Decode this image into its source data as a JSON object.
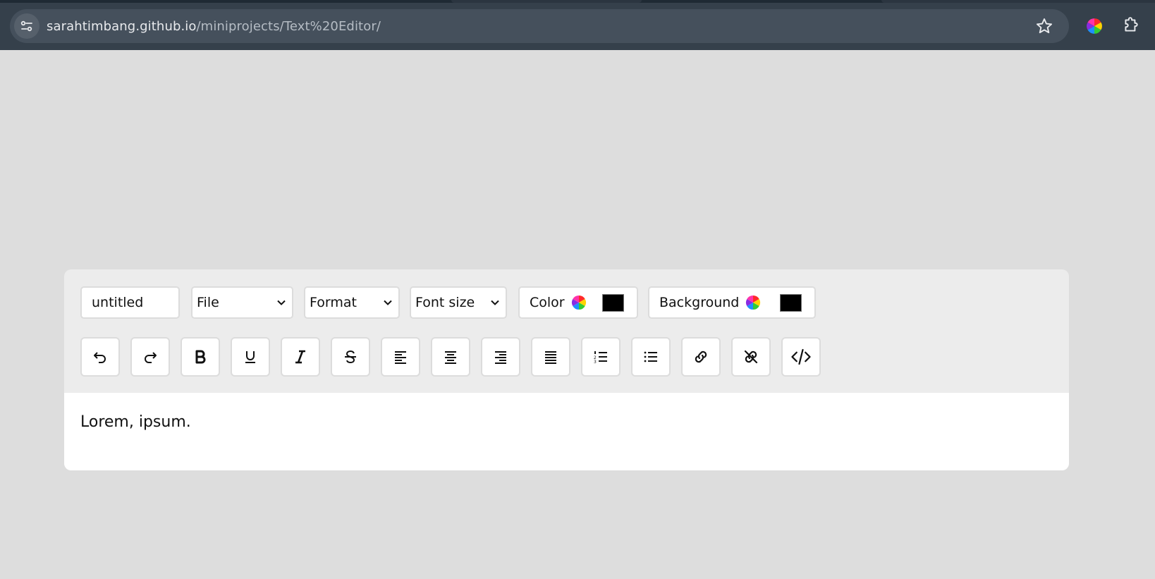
{
  "browser": {
    "url_domain": "sarahtimbang.github.io",
    "url_path": "/miniprojects/Text%20Editor/"
  },
  "editor": {
    "filename_value": "untitled",
    "file_select": "File",
    "format_select": "Format",
    "fontsize_select": "Font size",
    "color_label": "Color",
    "color_value": "#000000",
    "background_label": "Background",
    "background_value": "#000000",
    "content": "Lorem, ipsum."
  },
  "toolbar_buttons": [
    {
      "name": "undo",
      "icon": "undo-icon"
    },
    {
      "name": "redo",
      "icon": "redo-icon"
    },
    {
      "name": "bold",
      "icon": "bold-icon"
    },
    {
      "name": "underline",
      "icon": "underline-icon"
    },
    {
      "name": "italic",
      "icon": "italic-icon"
    },
    {
      "name": "strikethrough",
      "icon": "strikethrough-icon"
    },
    {
      "name": "align-left",
      "icon": "align-left-icon"
    },
    {
      "name": "align-center",
      "icon": "align-center-icon"
    },
    {
      "name": "align-right",
      "icon": "align-right-icon"
    },
    {
      "name": "justify",
      "icon": "align-justify-icon"
    },
    {
      "name": "ordered-list",
      "icon": "ordered-list-icon"
    },
    {
      "name": "unordered-list",
      "icon": "unordered-list-icon"
    },
    {
      "name": "link",
      "icon": "link-icon"
    },
    {
      "name": "unlink",
      "icon": "unlink-icon"
    },
    {
      "name": "code",
      "icon": "code-icon"
    }
  ]
}
